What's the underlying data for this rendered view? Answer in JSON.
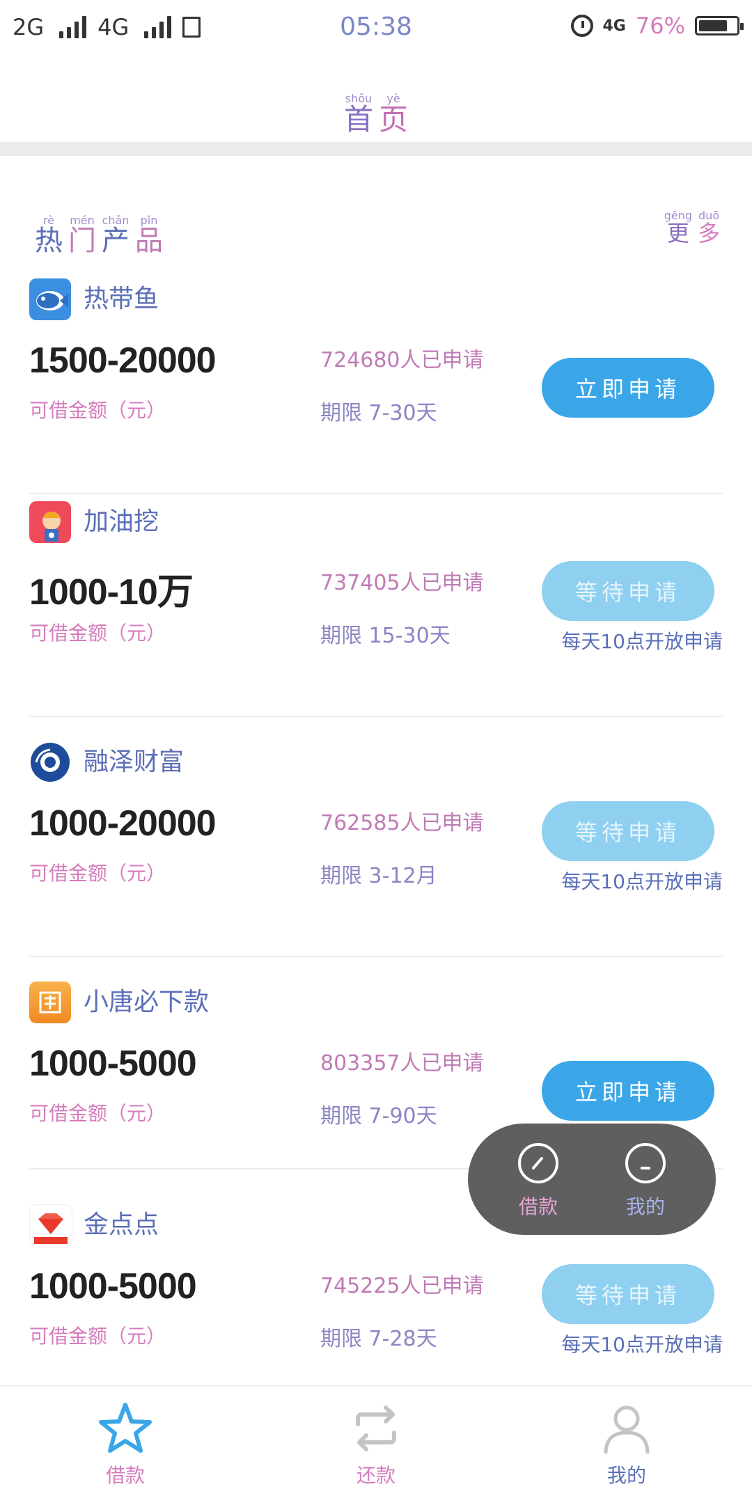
{
  "status_bar": {
    "network_left": "2G",
    "network_right": "4G",
    "sim_icon": "sim-icon",
    "time": "05:38",
    "net_type": "4G",
    "battery_percent": "76%",
    "battery_level": 0.76
  },
  "header": {
    "title": {
      "py": [
        "shǒu",
        "yè"
      ],
      "hz": [
        "首",
        "页"
      ]
    }
  },
  "section": {
    "title": {
      "py": [
        "rè",
        "mén",
        "chǎn",
        "pǐn"
      ],
      "hz": [
        "热",
        "门",
        "产",
        "品"
      ]
    },
    "more": {
      "py": [
        "gēng",
        "duō"
      ],
      "hz": [
        "更",
        "多"
      ]
    }
  },
  "products": [
    {
      "name": "热带鱼",
      "amount": "1500-20000",
      "amount_label": "可借金额（元）",
      "applicants": "724680人已申请",
      "term": "期限 7-30天",
      "button_label": "立即申请",
      "button_state": "active",
      "open_note": ""
    },
    {
      "name": "加油挖",
      "amount": "1000-10万",
      "amount_label": "可借金额（元）",
      "applicants": "737405人已申请",
      "term": "期限 15-30天",
      "button_label": "等待申请",
      "button_state": "waiting",
      "open_note": "每天10点开放申请"
    },
    {
      "name": "融泽财富",
      "amount": "1000-20000",
      "amount_label": "可借金额（元）",
      "applicants": "762585人已申请",
      "term": "期限 3-12月",
      "button_label": "等待申请",
      "button_state": "waiting",
      "open_note": "每天10点开放申请"
    },
    {
      "name": "小唐必下款",
      "amount": "1000-5000",
      "amount_label": "可借金额（元）",
      "applicants": "803357人已申请",
      "term": "期限 7-90天",
      "button_label": "立即申请",
      "button_state": "active",
      "open_note": ""
    },
    {
      "name": "金点点",
      "amount": "1000-5000",
      "amount_label": "可借金额（元）",
      "applicants": "745225人已申请",
      "term": "期限 7-28天",
      "button_label": "等待申请",
      "button_state": "waiting",
      "open_note": "每天10点开放申请"
    }
  ],
  "floating_menu": {
    "items": [
      {
        "label": "借款",
        "icon": "compass-icon"
      },
      {
        "label": "我的",
        "icon": "user-circle-icon"
      }
    ]
  },
  "bottom_nav": {
    "items": [
      {
        "label": "借款",
        "icon": "star-icon",
        "active": true
      },
      {
        "label": "还款",
        "icon": "repeat-icon",
        "active": false
      },
      {
        "label": "我的",
        "icon": "person-icon",
        "active": false
      }
    ]
  },
  "colors": {
    "accent_blue": "#3aa6e8",
    "waiting_blue": "#8fd0f1",
    "pinyin_pink": "#d67cbd",
    "title_purple": "#8a6fc0"
  }
}
